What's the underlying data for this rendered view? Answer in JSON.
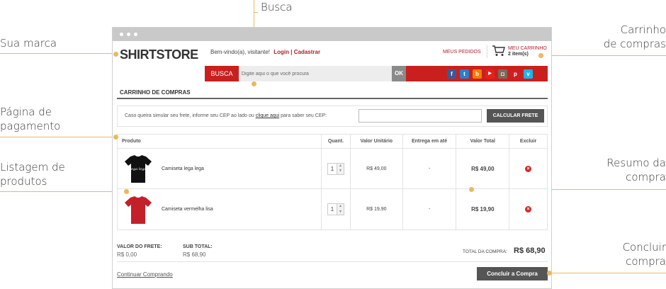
{
  "annotations": {
    "busca": "Busca",
    "sua_marca": "Sua marca",
    "pagina_pagamento_1": "Página de",
    "pagina_pagamento_2": "pagamento",
    "listagem_1": "Listagem de",
    "listagem_2": "produtos",
    "carrinho_1": "Carrinho",
    "carrinho_2": "de compras",
    "resumo_1": "Resumo da",
    "resumo_2": "compra",
    "concluir_1": "Concluir",
    "concluir_2": "compra"
  },
  "header": {
    "logo": "SHIRTSTORE",
    "welcome": "Bem-vindo(a), visitante!",
    "login_links": "Login | Cadastrar",
    "orders": "MEUS PEDIDOS",
    "cart_label": "MEU CARRINHO",
    "cart_count": "2 item(s)"
  },
  "search": {
    "button": "BUSCA",
    "placeholder": "Digite aqui o que você procura",
    "ok": "OK"
  },
  "social": [
    "f",
    "t",
    "b",
    "▶",
    "◘",
    "p",
    "v"
  ],
  "colors": {
    "brand_red": "#c9201f",
    "accent": "#e9b960"
  },
  "cart": {
    "title": "CARRINHO DE COMPRAS",
    "ship_text_before": "Caso queira simular seu frete, informe seu CEP ao lado ou ",
    "ship_link": "clique aqui",
    "ship_text_after": " para saber seu CEP:",
    "ship_button": "CALCULAR FRETE",
    "columns": [
      "Produto",
      "Quant.",
      "Valor Unitário",
      "Entrega em até",
      "Valor Total",
      "Excluir"
    ],
    "items": [
      {
        "name": "Camiseta lega lega",
        "shirt_text": "lega lega",
        "qty": "1",
        "unit": "R$ 49,00",
        "delivery": "-",
        "total": "R$ 49,00"
      },
      {
        "name": "Camiseta vermelha lisa",
        "qty": "1",
        "unit": "R$ 19,90",
        "delivery": "-",
        "total": "R$ 19,90"
      }
    ],
    "frete_label": "VALOR DO FRETE:",
    "frete_value": "R$ 0,00",
    "subtotal_label": "SUB TOTAL:",
    "subtotal_value": "R$ 68,90",
    "total_label": "TOTAL DA COMPRA:",
    "total_value": "R$ 68,90",
    "continue": "Continuar Comprando",
    "checkout": "Concluir a Compra"
  }
}
